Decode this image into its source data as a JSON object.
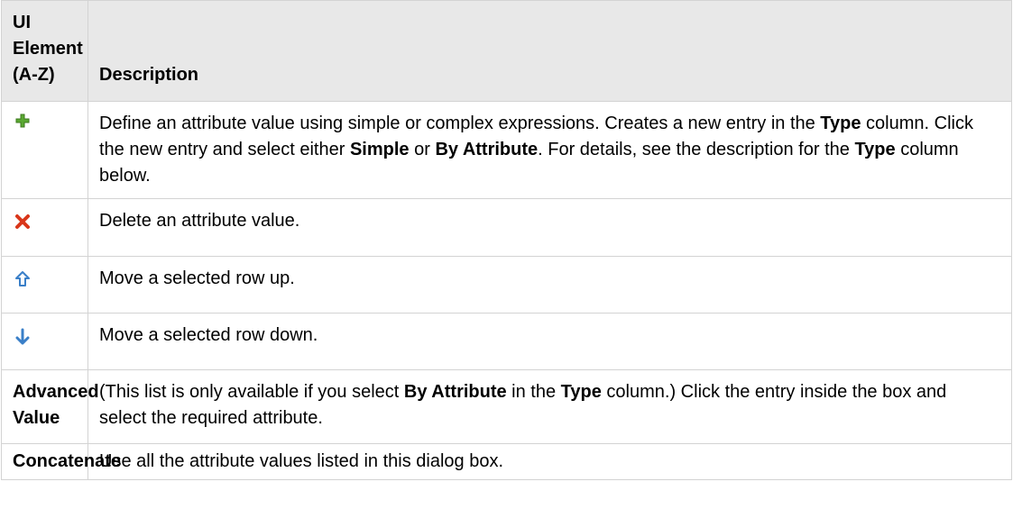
{
  "table": {
    "headers": {
      "element": "UI Element (A-Z)",
      "description": "Description"
    },
    "rows": [
      {
        "icon": "add-plus-icon",
        "description": {
          "t1": "Define an attribute value using simple or complex expressions. Creates a new entry in the ",
          "b1": "Type",
          "t2": " column. Click the new entry and select either ",
          "b2": "Simple",
          "t3": " or ",
          "b3": "By Attribute",
          "t4": ". For details, see the description for the ",
          "b4": "Type",
          "t5": " column below."
        }
      },
      {
        "icon": "delete-x-icon",
        "description": "Delete an attribute value."
      },
      {
        "icon": "move-up-arrow-icon",
        "description": "Move a selected row up."
      },
      {
        "icon": "move-down-arrow-icon",
        "description": "Move a selected row down."
      },
      {
        "element": "Advanced Value",
        "description": {
          "t1": "(This list is only available if you select ",
          "b1": "By Attribute",
          "t2": " in the ",
          "b2": "Type",
          "t3": " column.) Click the entry inside the box and select the required attribute."
        }
      },
      {
        "element": "Concatenate",
        "description": "Use all the attribute values listed in this dialog box."
      }
    ]
  },
  "colors": {
    "header_bg": "#e8e8e8",
    "border": "#d3d3d3",
    "plus_green": "#5aa832",
    "delete_red": "#d9371b",
    "arrow_blue": "#3a7fc8"
  }
}
